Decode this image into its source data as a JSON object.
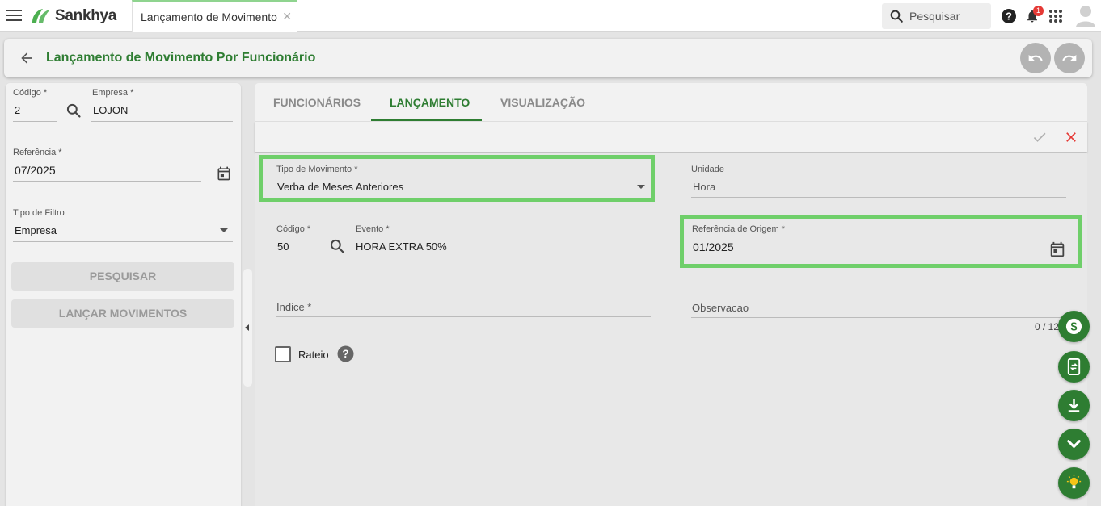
{
  "topbar": {
    "brand": "Sankhya",
    "tab_label": "Lançamento de Movimento",
    "tab_close": "✕",
    "search_placeholder": "Pesquisar",
    "notification_count": "1"
  },
  "header": {
    "title": "Lançamento de Movimento Por Funcionário"
  },
  "left": {
    "codigo_label": "Código *",
    "codigo_value": "2",
    "empresa_label": "Empresa *",
    "empresa_value": "LOJON",
    "referencia_label": "Referência *",
    "referencia_value": "07/2025",
    "tipo_filtro_label": "Tipo de Filtro",
    "tipo_filtro_value": "Empresa",
    "pesquisar_label": "PESQUISAR",
    "lancar_label": "LANÇAR MOVIMENTOS"
  },
  "tabs": [
    {
      "label": "FUNCIONÁRIOS"
    },
    {
      "label": "LANÇAMENTO"
    },
    {
      "label": "VISUALIZAÇÃO"
    }
  ],
  "form": {
    "tipo_movimento_label": "Tipo de Movimento *",
    "tipo_movimento_value": "Verba de Meses Anteriores",
    "unidade_label": "Unidade",
    "unidade_value": "Hora",
    "codigo_label": "Código *",
    "codigo_value": "50",
    "evento_label": "Evento *",
    "evento_value": "HORA EXTRA 50%",
    "ref_origem_label": "Referência de Origem *",
    "ref_origem_value": "01/2025",
    "indice_label": "Indice *",
    "observacao_label": "Observacao",
    "observacao_counter": "0 / 12",
    "rateio_label": "Rateio"
  },
  "colors": {
    "brand_green": "#2e7d32",
    "highlight": "#6fcf6a",
    "cancel_red": "#e53935"
  }
}
